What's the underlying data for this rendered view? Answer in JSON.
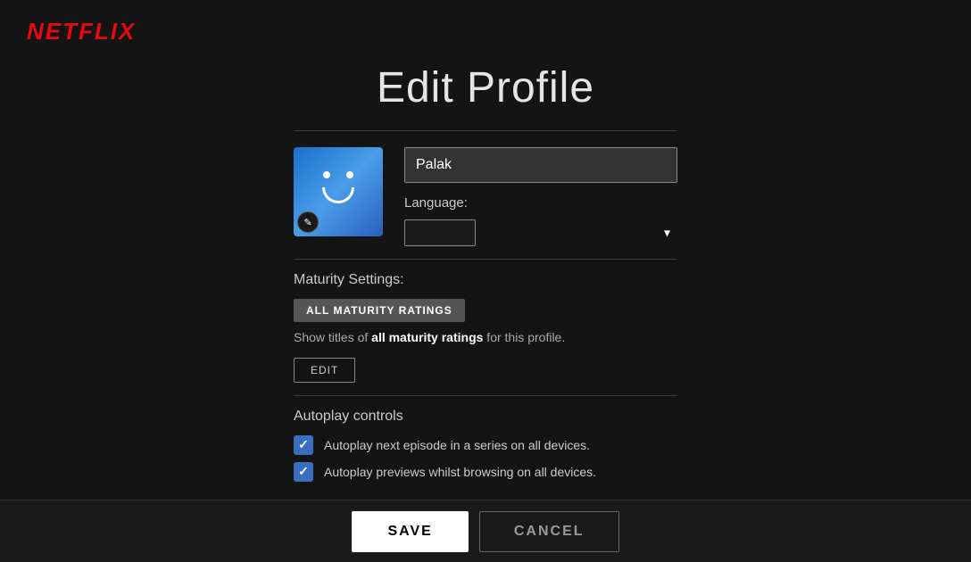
{
  "header": {
    "logo": "NETFLIX"
  },
  "page": {
    "title": "Edit Profile"
  },
  "profile": {
    "name": "Palak"
  },
  "language": {
    "label": "Language:"
  },
  "maturity": {
    "title": "Maturity Settings:",
    "badge_label": "ALL MATURITY RATINGS",
    "description_pre": "Show titles of ",
    "description_bold": "all maturity ratings",
    "description_post": " for this profile.",
    "edit_label": "EDIT"
  },
  "autoplay": {
    "title": "Autoplay controls",
    "option1": "Autoplay next episode in a series on all devices.",
    "option2": "Autoplay previews whilst browsing on all devices."
  },
  "buttons": {
    "save": "SAVE",
    "cancel": "CANCEL"
  },
  "colors": {
    "netflix_red": "#e50914",
    "accent_blue": "#3a6fbf"
  }
}
